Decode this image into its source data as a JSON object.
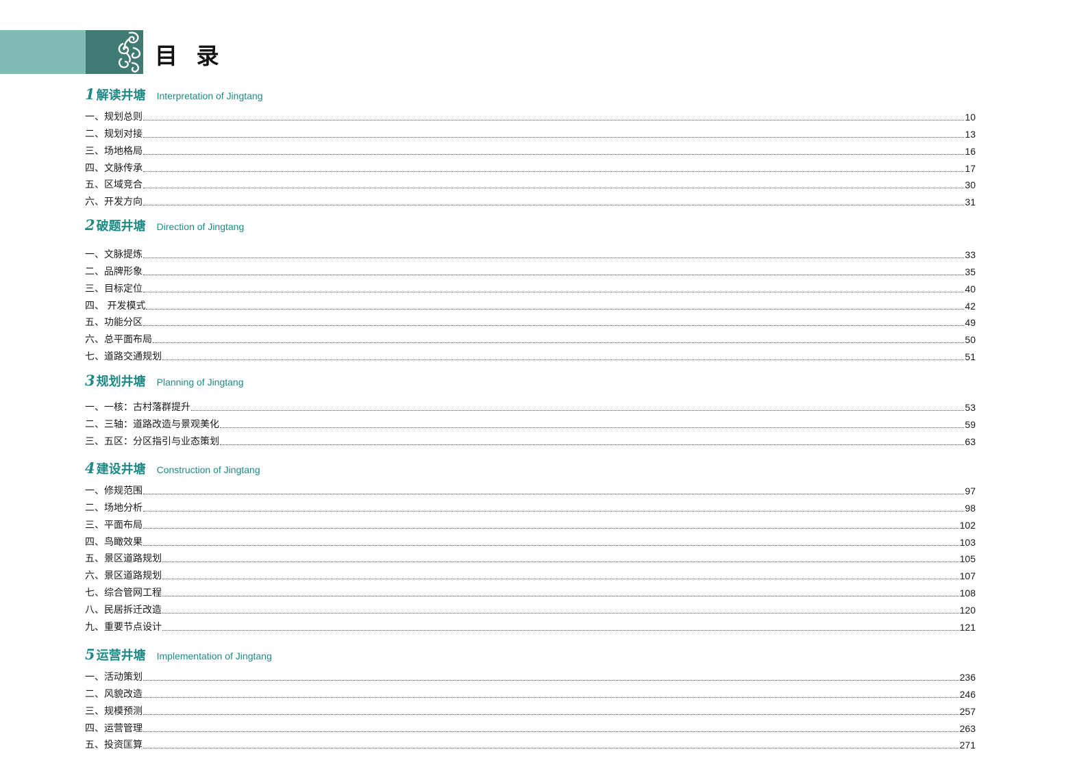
{
  "page": {
    "title": "目 录",
    "accent_color": "#1e8a86",
    "band_color": "#7fbcb4",
    "block_color": "#3f7a73",
    "ornament_icon": "cloud-scroll-icon"
  },
  "sections": [
    {
      "num": "1",
      "title": "解读井塘",
      "en": "Interpretation of Jingtang",
      "items": [
        {
          "label": "一、规划总则",
          "page": "10"
        },
        {
          "label": "二、规划对接",
          "page": "13"
        },
        {
          "label": "三、场地格局",
          "page": "16"
        },
        {
          "label": "四、文脉传承",
          "page": "17"
        },
        {
          "label": "五、区域竞合",
          "page": "30"
        },
        {
          "label": "六、开发方向",
          "page": "31"
        }
      ]
    },
    {
      "num": "2",
      "title": "破题井塘",
      "en": "Direction of Jingtang",
      "items": [
        {
          "label": "一、文脉提炼",
          "page": "33"
        },
        {
          "label": "二、品牌形象",
          "page": "35"
        },
        {
          "label": "三、目标定位",
          "page": "40"
        },
        {
          "label": "四、 开发模式",
          "page": "42"
        },
        {
          "label": "五、功能分区",
          "page": "49"
        },
        {
          "label": "六、总平面布局",
          "page": "50"
        },
        {
          "label": "七、道路交通规划",
          "page": "51"
        }
      ]
    },
    {
      "num": "3",
      "title": "规划井塘",
      "en": "Planning of Jingtang",
      "items": [
        {
          "label": "一、一核：古村落群提升",
          "page": "53"
        },
        {
          "label": "二、三轴：道路改造与景观美化",
          "page": "59"
        },
        {
          "label": "三、五区：分区指引与业态策划",
          "page": "63"
        }
      ]
    },
    {
      "num": "4",
      "title": "建设井塘",
      "en": "Construction of  Jingtang",
      "items": [
        {
          "label": "一、修规范围",
          "page": "97"
        },
        {
          "label": "二、场地分析",
          "page": "98"
        },
        {
          "label": "三、平面布局",
          "page": "102"
        },
        {
          "label": "四、鸟瞰效果",
          "page": "103"
        },
        {
          "label": "五、景区道路规划",
          "page": "105"
        },
        {
          "label": "六、景区道路规划",
          "page": "107"
        },
        {
          "label": "七、综合管网工程",
          "page": "108"
        },
        {
          "label": "八、民居拆迁改造",
          "page": "120"
        },
        {
          "label": "九、重要节点设计",
          "page": "121"
        }
      ]
    },
    {
      "num": "5",
      "title": "运营井塘",
      "en": "Implementation of Jingtang",
      "items": [
        {
          "label": "一、活动策划",
          "page": "236"
        },
        {
          "label": "二、风貌改造",
          "page": "246"
        },
        {
          "label": "三、规模预测",
          "page": "257"
        },
        {
          "label": "四、运营管理",
          "page": "263"
        },
        {
          "label": "五、投资匡算",
          "page": "271"
        }
      ]
    }
  ]
}
